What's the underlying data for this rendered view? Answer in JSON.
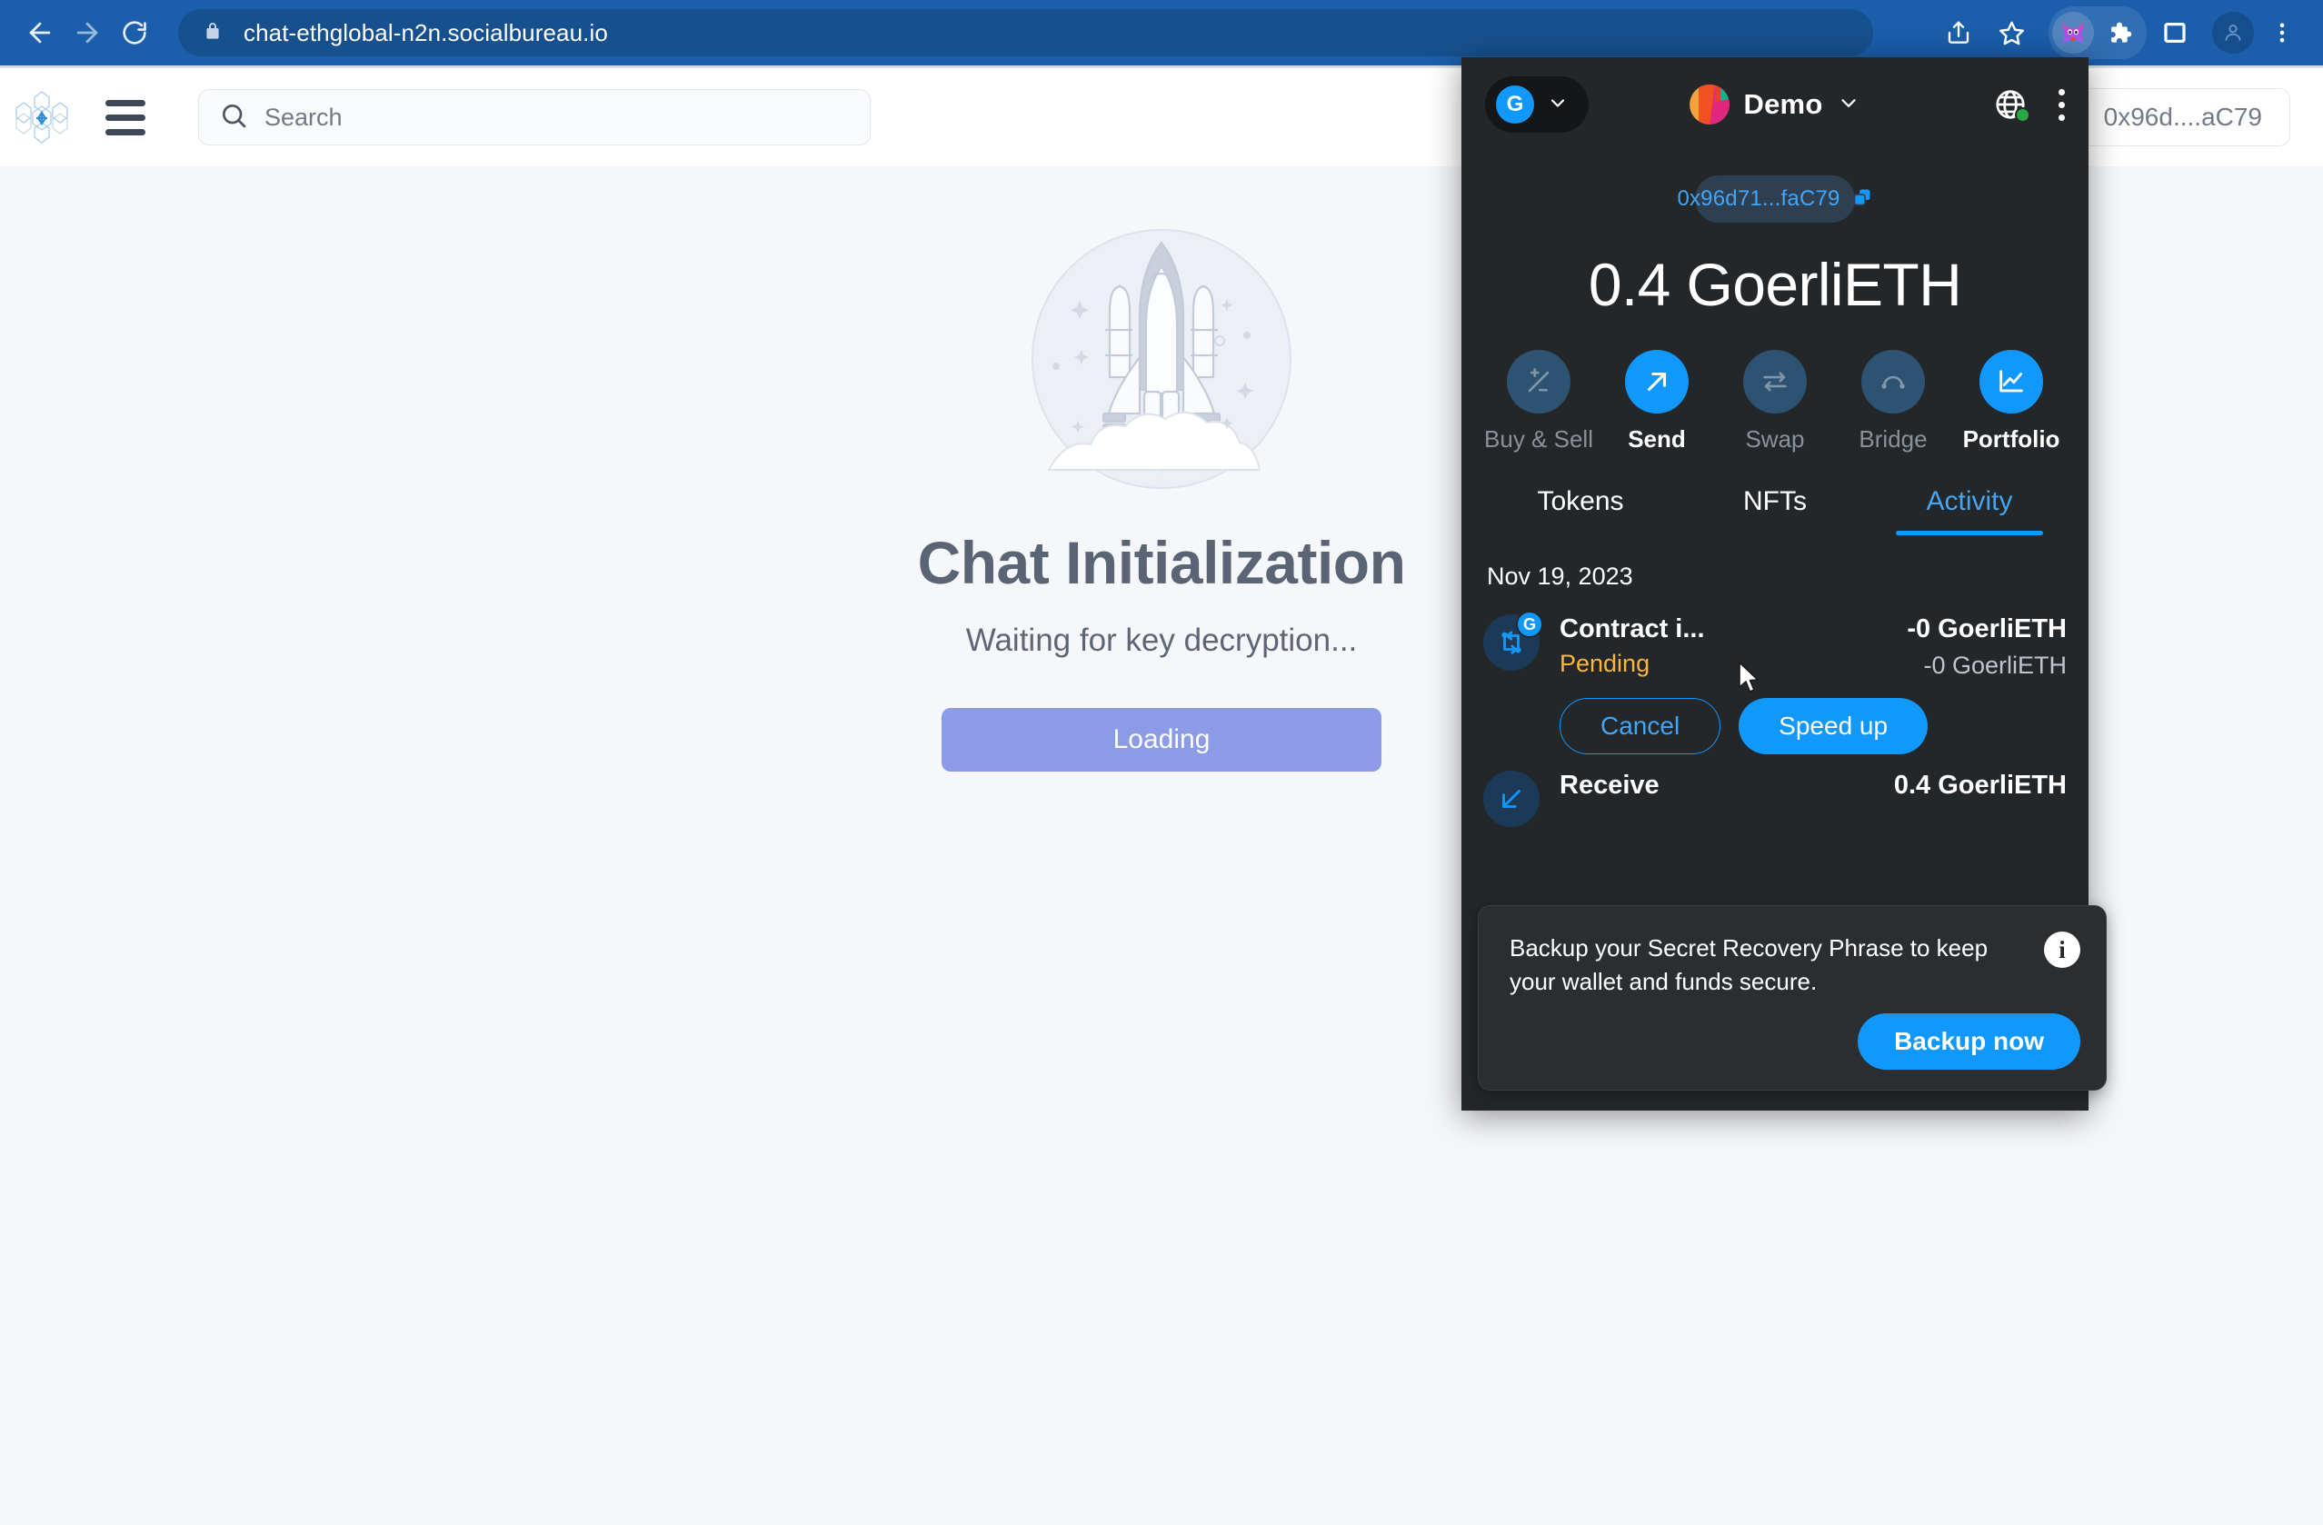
{
  "browser": {
    "url": "chat-ethglobal-n2n.socialbureau.io",
    "back_label": "Back",
    "forward_label": "Forward",
    "reload_label": "Reload",
    "lock_icon": "lock-icon",
    "share_icon": "share-icon",
    "bookmark_icon": "star-icon",
    "metamask_icon": "metamask-fox-icon",
    "extensions_icon": "puzzle-piece-icon",
    "sidepanel_icon": "side-panel-icon",
    "profile_icon": "profile-avatar-icon",
    "menu_icon": "three-dot-menu-icon"
  },
  "app": {
    "logo_icon": "cube-network-logo",
    "menu_icon": "hamburger-menu-icon",
    "search": {
      "icon": "search-icon",
      "value": "",
      "placeholder": "Search"
    },
    "wallet_address": "0x96d....aC79"
  },
  "empty_state": {
    "illustration": "rocket-launch-illustration",
    "title": "Chat Initialization",
    "subtitle": "Waiting for key decryption...",
    "button_label": "Loading"
  },
  "metamask": {
    "header": {
      "network_badge": "G",
      "network_chevron_icon": "chevron-down-icon",
      "account_avatar": "account-identicon",
      "account_name": "Demo",
      "account_chevron_icon": "chevron-down-icon",
      "connection_icon": "globe-icon",
      "connection_status_color": "#28a745",
      "menu_icon": "three-dot-menu-icon"
    },
    "address": "0x96d71...faC79",
    "copy_icon": "copy-icon",
    "balance": "0.4 GoerliETH",
    "actions": [
      {
        "label": "Buy & Sell",
        "icon": "buy-sell-icon",
        "state": "disabled"
      },
      {
        "label": "Send",
        "icon": "send-arrow-icon",
        "state": "enabled"
      },
      {
        "label": "Swap",
        "icon": "swap-arrows-icon",
        "state": "disabled"
      },
      {
        "label": "Bridge",
        "icon": "bridge-arc-icon",
        "state": "disabled"
      },
      {
        "label": "Portfolio",
        "icon": "portfolio-chart-icon",
        "state": "enabled"
      }
    ],
    "tabs": [
      {
        "label": "Tokens",
        "active": false
      },
      {
        "label": "NFTs",
        "active": false
      },
      {
        "label": "Activity",
        "active": true
      }
    ],
    "activity": {
      "date": "Nov 19, 2023",
      "transactions": [
        {
          "icon": "contract-interaction-icon",
          "network_badge": "G",
          "title": "Contract i...",
          "status": "Pending",
          "status_color": "#f8b73c",
          "amount_primary": "-0 GoerliETH",
          "amount_secondary": "-0 GoerliETH",
          "cancel_label": "Cancel",
          "speedup_label": "Speed up"
        },
        {
          "icon": "receive-icon",
          "title": "Receive",
          "amount_primary": "0.4 GoerliETH"
        }
      ]
    },
    "backup_notification": {
      "message": "Backup your Secret Recovery Phrase to keep your wallet and funds secure.",
      "info_icon": "info-icon",
      "button_label": "Backup now"
    },
    "colors": {
      "accent": "#1098fc",
      "background": "#24272a",
      "warning": "#f8b73c"
    }
  }
}
